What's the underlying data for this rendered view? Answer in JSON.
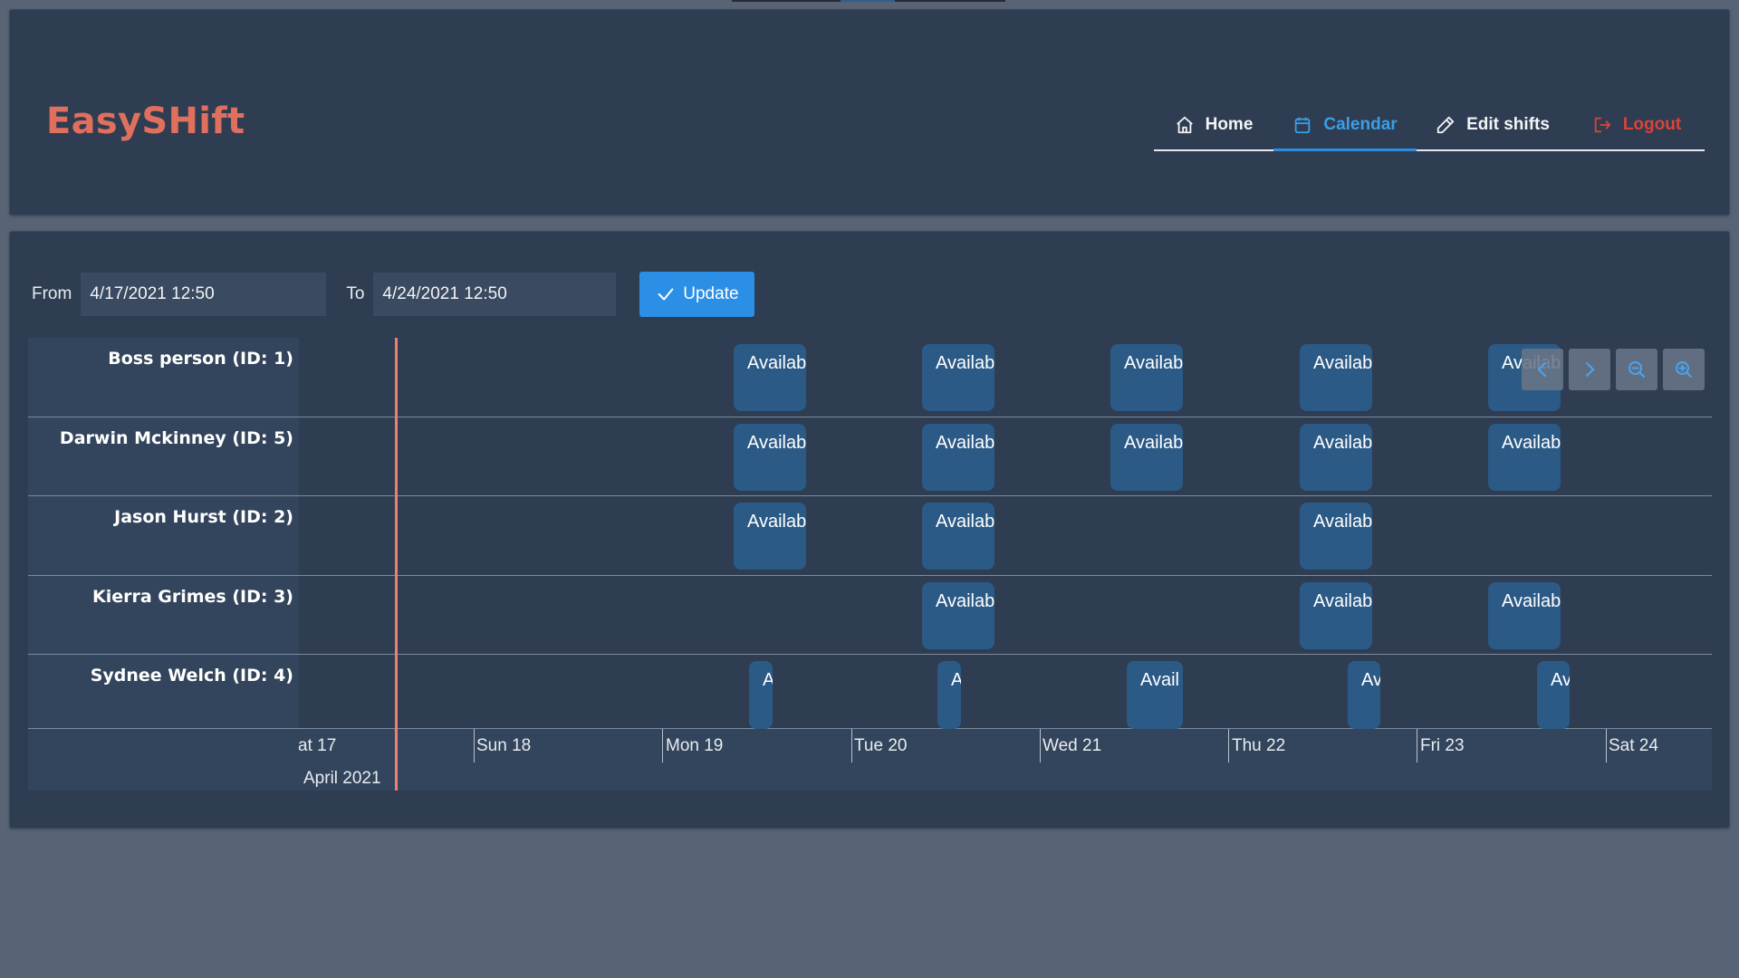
{
  "app": {
    "brand": "EasySHift"
  },
  "nav": {
    "items": [
      {
        "label": "Home",
        "icon": "home-icon",
        "active": false
      },
      {
        "label": "Calendar",
        "icon": "calendar-icon",
        "active": true
      },
      {
        "label": "Edit shifts",
        "icon": "pencil-icon",
        "active": false
      },
      {
        "label": "Logout",
        "icon": "logout-icon",
        "active": false
      }
    ]
  },
  "filter": {
    "from_label": "From",
    "from_value": "4/17/2021 12:50",
    "to_label": "To",
    "to_value": "4/24/2021 12:50",
    "update_label": "Update"
  },
  "timeline": {
    "rows": [
      {
        "label": "Boss person (ID: 1)",
        "items": [
          "Availab",
          "Availab",
          "Availab",
          "Availab",
          "Availab"
        ]
      },
      {
        "label": "Darwin Mckinney (ID: 5)",
        "items": [
          "Availab",
          "Availab",
          "Availab",
          "Availab",
          "Availab"
        ]
      },
      {
        "label": "Jason Hurst (ID: 2)",
        "items": [
          "Availab",
          "Availab",
          "Availab"
        ]
      },
      {
        "label": "Kierra Grimes (ID: 3)",
        "items": [
          "Availab",
          "Availab",
          "Availab"
        ]
      },
      {
        "label": "Sydnee Welch (ID: 4)",
        "items": [
          "A",
          "A",
          "Avail",
          "Av",
          "Av"
        ]
      }
    ],
    "axis": {
      "days": [
        "at 17",
        "Sun 18",
        "Mon 19",
        "Tue 20",
        "Wed 21",
        "Thu 22",
        "Fri 23",
        "Sat 24"
      ],
      "month": "April 2021"
    },
    "controls": [
      "chevron-left-icon",
      "chevron-right-icon",
      "zoom-out-icon",
      "zoom-in-icon"
    ]
  },
  "colors": {
    "background": "#586476",
    "card": "#2e3d51",
    "brand": "#e06f5e",
    "accent": "#2c8fe6",
    "item": "#2b5a86",
    "current_time": "#ef7f72",
    "logout": "#d9433b"
  }
}
